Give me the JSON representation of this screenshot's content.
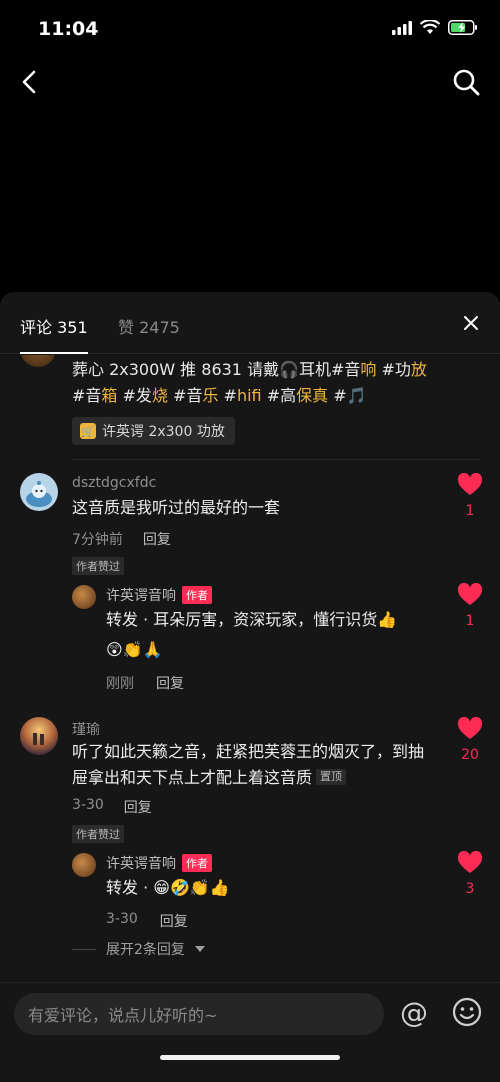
{
  "status_bar": {
    "time": "11:04"
  },
  "tabs": {
    "comments": "评论 351",
    "likes": "赞 2475"
  },
  "post": {
    "text_parts": [
      {
        "t": "葬心 2x300W 推 8631 请戴🎧耳机#音",
        "hl": false
      },
      {
        "t": "响",
        "hl": true
      },
      {
        "t": " #功",
        "hl": false
      },
      {
        "t": "放",
        "hl": true
      },
      {
        "t": " #音",
        "hl": false
      },
      {
        "t": "箱",
        "hl": true
      },
      {
        "t": " #发",
        "hl": false
      },
      {
        "t": "烧",
        "hl": true
      },
      {
        "t": " #音",
        "hl": false
      },
      {
        "t": "乐",
        "hl": true
      },
      {
        "t": " #",
        "hl": false
      },
      {
        "t": "hifi",
        "hl": true
      },
      {
        "t": " #高",
        "hl": false
      },
      {
        "t": "保真",
        "hl": true
      },
      {
        "t": " #🎵",
        "hl": false
      }
    ],
    "product_tag": "许英谔 2x300 功放"
  },
  "comments": [
    {
      "name": "dsztdgcxfdc",
      "text": "这音质是我听过的最好的一套",
      "time": "7分钟前",
      "reply_label": "回复",
      "liked_badge": "作者赞过",
      "likes": "1",
      "reply": {
        "name": "许英谔音响",
        "author_badge": "作者",
        "text_line1": "转发 · 耳朵厉害，资深玩家，懂行识货👍",
        "text_line2": "😲👏🙏",
        "time": "刚刚",
        "reply_label": "回复",
        "likes": "1"
      }
    },
    {
      "name": "瑾瑜",
      "text": "听了如此天籁之音，赶紧把芙蓉王的烟灭了，到抽屉拿出和天下点上才配上着这音质",
      "pinned": "置顶",
      "time": "3-30",
      "reply_label": "回复",
      "liked_badge": "作者赞过",
      "likes": "20",
      "reply": {
        "name": "许英谔音响",
        "author_badge": "作者",
        "text_line1": "转发 · 😁🤣👏👍",
        "time": "3-30",
        "reply_label": "回复",
        "likes": "3"
      },
      "expand": "展开2条回复"
    }
  ],
  "input": {
    "placeholder": "有爱评论，说点儿好听的~"
  },
  "colors": {
    "accent": "#fe2c55",
    "hashtag": "#f0b63c",
    "sheet_bg": "#161616"
  }
}
